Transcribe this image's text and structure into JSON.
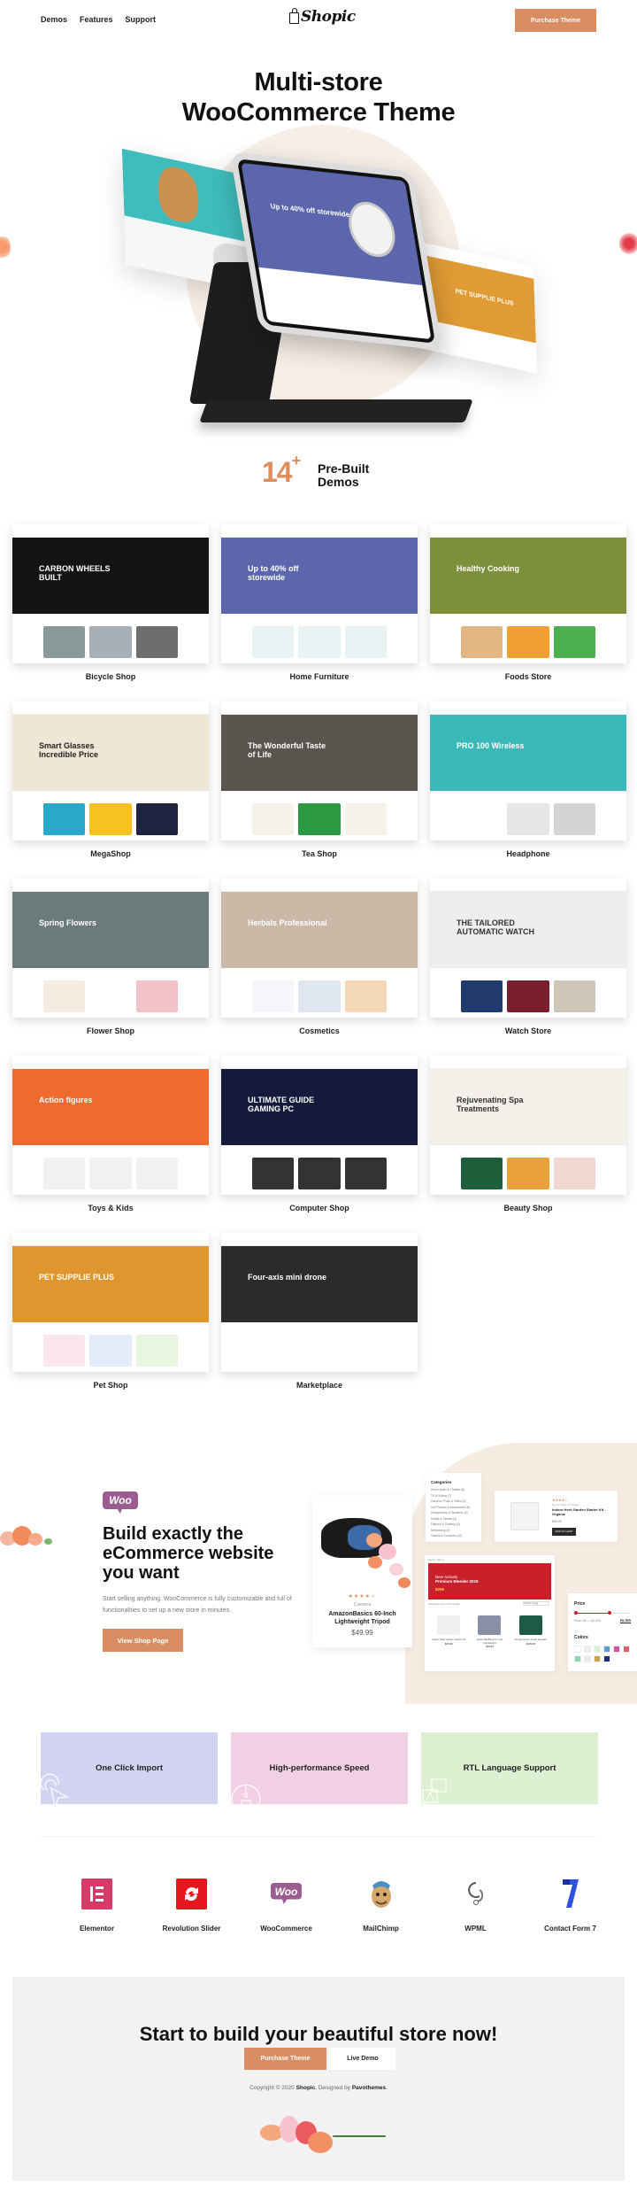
{
  "header": {
    "nav": [
      "Demos",
      "Features",
      "Support"
    ],
    "logo_text": "Shopic",
    "purchase_label": "Purchase Theme"
  },
  "hero": {
    "title_line1": "Multi-store",
    "title_line2": "WooCommerce Theme",
    "tablet_promo": "Up to 40% off storewide",
    "right_screen_label": "PET SUPPLIE PLUS"
  },
  "demos": {
    "count": "14",
    "plus": "+",
    "label_line1": "Pre-Built",
    "label_line2": "Demos",
    "items": [
      {
        "name": "Bicycle Shop",
        "banner_text": "CARBON WHEELS BUILT",
        "banner_color": "#141414",
        "text_color": "#ffffff",
        "tiles": [
          "#8a9a9a",
          "#a6b0b6",
          "#6e6e6e"
        ]
      },
      {
        "name": "Home Furniture",
        "banner_text": "Up to 40% off storewide",
        "banner_color": "#5b66ad",
        "text_color": "#ffffff",
        "tiles": [
          "#e9f3f4",
          "#e9f3f4",
          "#e9f3f4"
        ]
      },
      {
        "name": "Foods Store",
        "banner_text": "Healthy Cooking",
        "banner_color": "#7e8f3a",
        "text_color": "#ffffff",
        "tiles": [
          "#e2b783",
          "#f0a030",
          "#4caf50"
        ]
      },
      {
        "name": "MegaShop",
        "banner_text": "Smart Glasses Incredible Price",
        "banner_color": "#efe6d6",
        "text_color": "#222222",
        "tiles": [
          "#2aa7c9",
          "#f7c221",
          "#1d2440"
        ]
      },
      {
        "name": "Tea Shop",
        "banner_text": "The Wonderful Taste of Life",
        "banner_color": "#5a554e",
        "text_color": "#ffffff",
        "tiles": [
          "#f6f2ea",
          "#2d9a43",
          "#f6f2ea"
        ]
      },
      {
        "name": "Headphone",
        "banner_text": "PRO 100 Wireless",
        "banner_color": "#3bb9b8",
        "text_color": "#ffffff",
        "tiles": [
          "#ffffff",
          "#e6e6e6",
          "#d4d4d4"
        ]
      },
      {
        "name": "Flower Shop",
        "banner_text": "Spring Flowers",
        "banner_color": "#6b7a7a",
        "text_color": "#ffffff",
        "tiles": [
          "#f6ede2",
          "#ffffff",
          "#f1c3c8"
        ]
      },
      {
        "name": "Cosmetics",
        "banner_text": "Herbals Professional",
        "banner_color": "#cbb9a8",
        "text_color": "#ffffff",
        "tiles": [
          "#f4f6f9",
          "#dfe6f0",
          "#f4d7b6"
        ]
      },
      {
        "name": "Watch Store",
        "banner_text": "THE TAILORED AUTOMATIC WATCH",
        "banner_color": "#eeeeee",
        "text_color": "#333333",
        "tiles": [
          "#1f3a6b",
          "#7a1f2e",
          "#cfc6b8"
        ]
      },
      {
        "name": "Toys & Kids",
        "banner_text": "Action figures",
        "banner_color": "#ee6a2f",
        "text_color": "#ffffff",
        "tiles": [
          "#f1f1f1",
          "#f1f1f1",
          "#f1f1f1"
        ]
      },
      {
        "name": "Computer Shop",
        "banner_text": "ULTIMATE GUIDE GAMING PC",
        "banner_color": "#141a3c",
        "text_color": "#ffffff",
        "tiles": [
          "#333333",
          "#333333",
          "#333333"
        ]
      },
      {
        "name": "Beauty Shop",
        "banner_text": "Rejuvenating Spa Treatments",
        "banner_color": "#f3efe9",
        "text_color": "#333333",
        "tiles": [
          "#1e5e3a",
          "#e9a23b",
          "#eed8d0"
        ]
      },
      {
        "name": "Pet Shop",
        "banner_text": "PET SUPPLIE PLUS",
        "banner_color": "#e0962f",
        "text_color": "#ffffff",
        "tiles": [
          "#fbe6ef",
          "#e3ecfb",
          "#e7f7df"
        ]
      },
      {
        "name": "Marketplace",
        "banner_text": "Four-axis mini drone",
        "banner_color": "#2b2b2b",
        "text_color": "#ffffff",
        "tiles": [
          "#ffffff",
          "#ffffff",
          "#ffffff"
        ]
      }
    ]
  },
  "woo": {
    "badge": "Woo",
    "title": "Build exactly the eCommerce website you want",
    "description": "Start selling anything. WooCommerce is fully customizable and full of functionalities to set up a new store in minutes.",
    "button_label": "View Shop Page",
    "product": {
      "rating": "★★★★☆",
      "category": "Camera",
      "name": "AmazonBasics 60-Inch Lightweight Tripod",
      "price": "$49.99"
    },
    "categories_title": "Categories",
    "categories": [
      "Home Audio & Theater (6)",
      "TV & Videos (7)",
      "Camera, Photo & Video (4)",
      "Cell Phones & Accessories (6)",
      "Headphones & Speakers (5)",
      "Mobile & Tablets (4)",
      "Fashion & Clothing (3)",
      "Networking (4)",
      "Games & Consoles (10)"
    ],
    "featured_item": {
      "rating": "★★★★☆",
      "category": "Home Audio & Theater",
      "name": "Indoor Herb Garden Starter Kit - Organic",
      "price": "$25.99",
      "add_to_cart": "ADD TO CART"
    },
    "shop": {
      "breadcrumb": "Home / Shop",
      "banner_line1": "New Arrivals",
      "banner_line2": "Premium Blender 2019",
      "banner_price": "$299",
      "results": "Showing 1-12 of 36 results",
      "sort": "Default sorting",
      "products": [
        {
          "name": "Indoor Herb Garden Starter Kit",
          "price": "$25.99",
          "color": "#f0f0f0"
        },
        {
          "name": "Apple MacBook 12-Inch Lightweight",
          "price": "$49.99",
          "color": "#8a8fa8"
        },
        {
          "name": "Google Home Smart Speaker",
          "price": "$129.99",
          "color": "#1f5a45"
        }
      ]
    },
    "filter": {
      "price_title": "Price",
      "price_range": "Price: $5 — $1,024",
      "filter_label": "FILTER",
      "range_low": 0.0,
      "range_high": 0.62,
      "colors_title": "Colors",
      "swatches": [
        "#ffffff",
        "#eef0e8",
        "#d8eed6",
        "#5b9bd8",
        "#d94fa8",
        "#d9616b",
        "#8fd6b5",
        "#f2e6f6",
        "#c9a24a",
        "#1d2b7a"
      ]
    }
  },
  "features": [
    {
      "label": "One Click Import",
      "bg": "#d1d3f1",
      "icon": "cursor-click-icon"
    },
    {
      "label": "High-performance Speed",
      "bg": "#f1d0e3",
      "icon": "speedometer-icon"
    },
    {
      "label": "RTL Language Support",
      "bg": "#ddf0d2",
      "icon": "translate-icon"
    }
  ],
  "integrations": [
    {
      "name": "Elementor",
      "color": "#d63a69",
      "icon": "elementor-icon"
    },
    {
      "name": "Revolution Slider",
      "color": "#e5161c",
      "icon": "revolution-slider-icon"
    },
    {
      "name": "WooCommerce",
      "color": "#9b5c8f",
      "icon": "woocommerce-icon"
    },
    {
      "name": "MailChimp",
      "color": "#5a4a3a",
      "icon": "mailchimp-icon"
    },
    {
      "name": "WPML",
      "color": "#555555",
      "icon": "wpml-icon"
    },
    {
      "name": "Contact Form 7",
      "color": "#2d52e0",
      "icon": "contact-form-7-icon"
    }
  ],
  "cta": {
    "title": "Start to build your beautiful store now!",
    "purchase_label": "Purchase Theme",
    "live_demo_label": "Live Demo",
    "copyright_prefix": "Copyright © 2020 ",
    "copyright_brand": "Shopic",
    "copyright_mid": ". Designed by ",
    "copyright_author": "Pavothemes",
    "copyright_suffix": "."
  },
  "colors": {
    "accent": "#d98d62",
    "accent_text": "#e08c5b",
    "cream": "#f6ece2"
  }
}
